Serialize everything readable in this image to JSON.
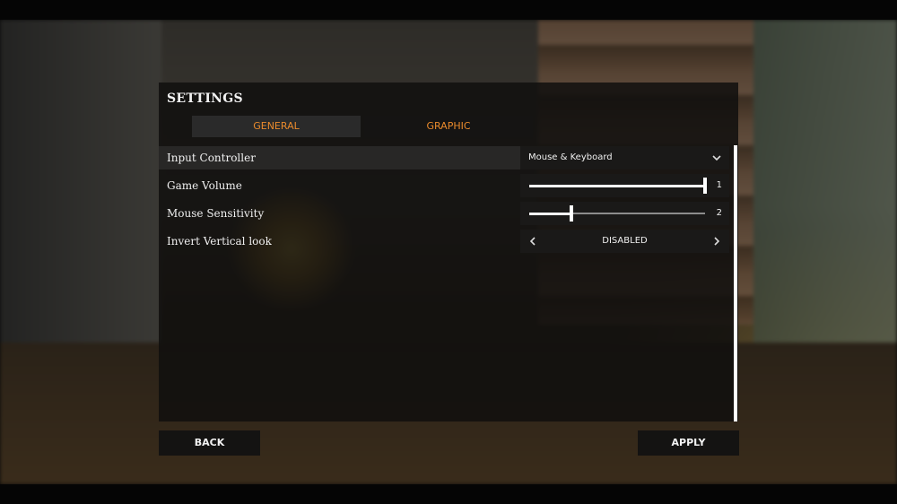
{
  "settings": {
    "title": "SETTINGS",
    "tabs": [
      {
        "label": "GENERAL",
        "active": true
      },
      {
        "label": "GRAPHIC",
        "active": false
      }
    ],
    "rows": [
      {
        "label": "Input Controller",
        "control": "dropdown",
        "value": "Mouse & Keyboard"
      },
      {
        "label": "Game Volume",
        "control": "slider",
        "value": "1",
        "level": 1.0
      },
      {
        "label": "Mouse Sensitivity",
        "control": "slider",
        "value": "2",
        "level": 0.24
      },
      {
        "label": "Invert Vertical look",
        "control": "selector",
        "value": "DISABLED"
      }
    ]
  },
  "buttons": {
    "back": "BACK",
    "apply": "APPLY"
  },
  "colors": {
    "accent": "#e98a2c",
    "panel": "#100f0e",
    "text": "#efefef"
  },
  "icons": {
    "dropdown": "chevron-down-icon",
    "prev": "chevron-left-icon",
    "next": "chevron-right-icon"
  }
}
